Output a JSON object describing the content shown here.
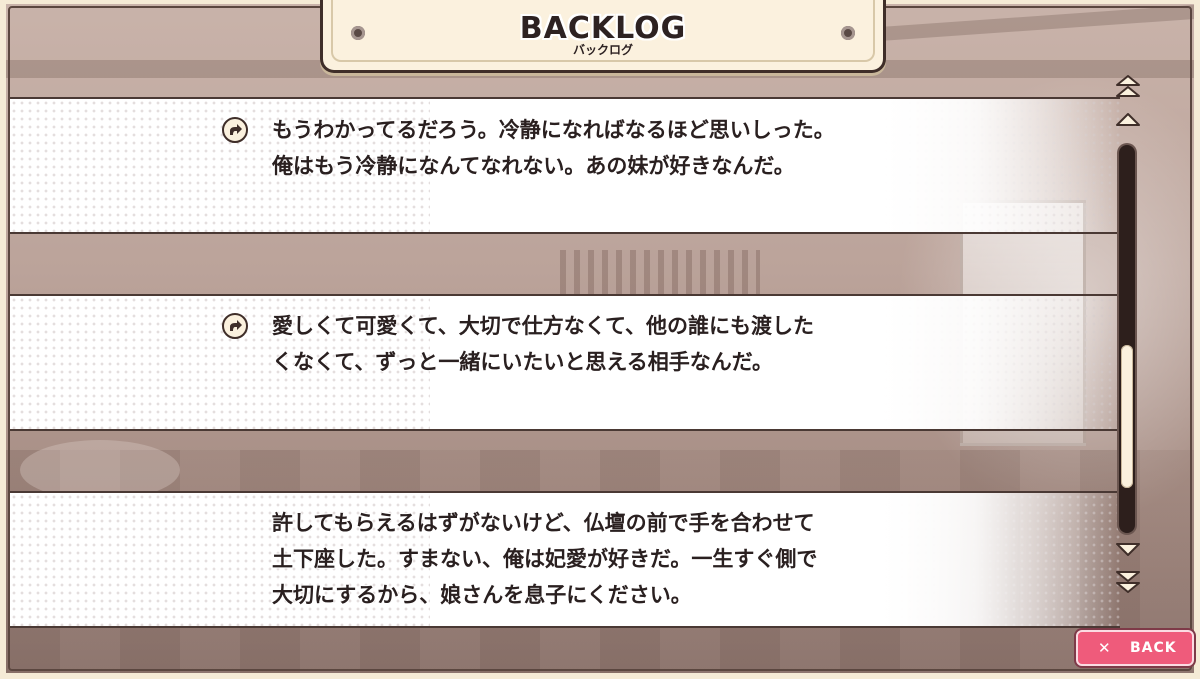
{
  "header": {
    "title": "BACKLOG",
    "subtitle": "バックログ"
  },
  "log": {
    "entries": [
      {
        "text": "もうわかってるだろう。冷静になればなるほど思いしった。\n俺はもう冷静になんてなれない。あの妹が好きなんだ。",
        "has_voice": true,
        "voice_icon": "voice-replay-icon"
      },
      {
        "text": "愛しくて可愛くて、大切で仕方なくて、他の誰にも渡した\nくなくて、ずっと一緒にいたいと思える相手なんだ。",
        "has_voice": true,
        "voice_icon": "voice-replay-icon"
      },
      {
        "text": "許してもらえるはずがないけど、仏壇の前で手を合わせて\n土下座した。すまない、俺は妃愛が好きだ。一生すぐ側で\n大切にするから、娘さんを息子にください。",
        "has_voice": false
      }
    ]
  },
  "scrollbar": {
    "icons": [
      "scroll-to-top-icon",
      "scroll-up-icon",
      "scroll-down-icon",
      "scroll-to-bottom-icon"
    ],
    "position": 0.82,
    "visible_fraction": 0.38
  },
  "footer": {
    "back_label": "BACK",
    "back_icon": "close-icon"
  },
  "colors": {
    "frame": "#f5ebd6",
    "plate": "#fbf1de",
    "dark": "#2d1f1c",
    "back_button": "#ef5b7b"
  }
}
